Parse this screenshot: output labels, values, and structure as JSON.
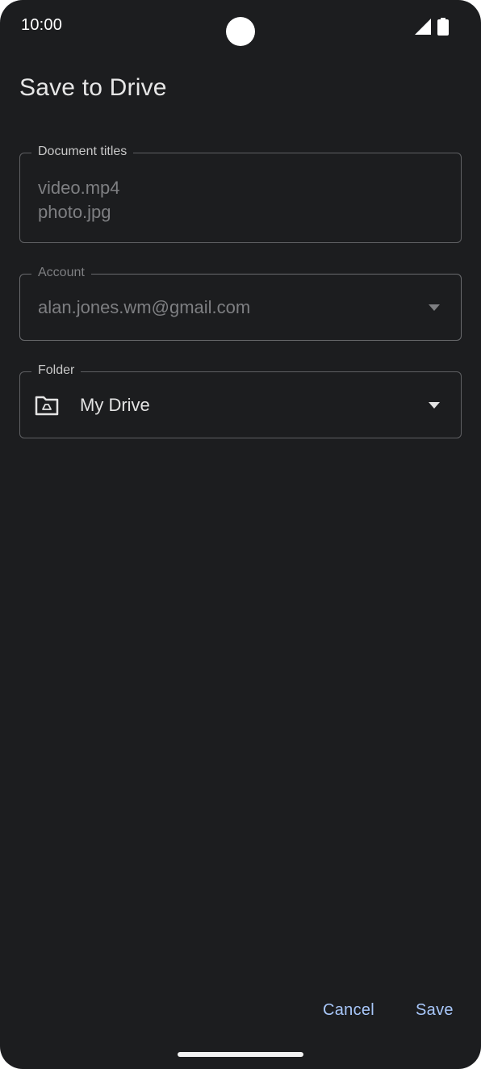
{
  "status_bar": {
    "time": "10:00",
    "icons": [
      "camera-cutout",
      "signal-icon",
      "battery-icon"
    ]
  },
  "dialog": {
    "title": "Save to Drive",
    "document_titles": {
      "label": "Document titles",
      "lines": [
        "video.mp4",
        "photo.jpg"
      ]
    },
    "account": {
      "label": "Account",
      "value": "alan.jones.wm@gmail.com",
      "icon": "dropdown-arrow-icon"
    },
    "folder": {
      "label": "Folder",
      "value": "My Drive",
      "icon": "drive-folder-icon",
      "arrow_icon": "dropdown-arrow-icon"
    },
    "actions": {
      "cancel_label": "Cancel",
      "save_label": "Save"
    }
  },
  "colors": {
    "background": "#1c1d1f",
    "accent": "#a8c7fa",
    "outline": "#5f6063",
    "text_primary": "#e3e3e3",
    "text_disabled": "#7e7f82"
  }
}
